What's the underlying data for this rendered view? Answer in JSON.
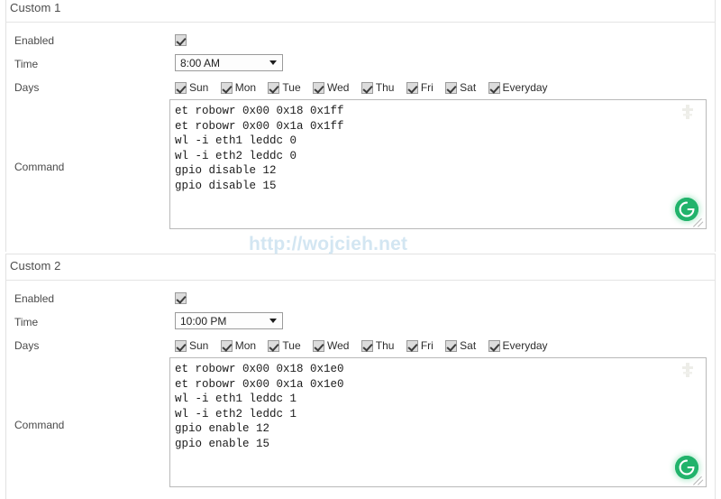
{
  "watermark": "http://wojcieh.net",
  "labels": {
    "enabled": "Enabled",
    "time": "Time",
    "days": "Days",
    "command": "Command"
  },
  "days": [
    "Sun",
    "Mon",
    "Tue",
    "Wed",
    "Thu",
    "Fri",
    "Sat",
    "Everyday"
  ],
  "colors": {
    "accent_green": "#21b36b",
    "watermark_blue": "#d3e6f2",
    "border_gray": "#e2e2e2"
  },
  "sections": [
    {
      "title": "Custom 1",
      "enabled": true,
      "time": "8:00 AM",
      "days_checked": [
        true,
        true,
        true,
        true,
        true,
        true,
        true,
        true
      ],
      "command": "et robowr 0x00 0x18 0x1ff\net robowr 0x00 0x1a 0x1ff\nwl -i eth1 leddc 0\nwl -i eth2 leddc 0\ngpio disable 12\ngpio disable 15"
    },
    {
      "title": "Custom 2",
      "enabled": true,
      "time": "10:00 PM",
      "days_checked": [
        true,
        true,
        true,
        true,
        true,
        true,
        true,
        true
      ],
      "command": "et robowr 0x00 0x18 0x1e0\net robowr 0x00 0x1a 0x1e0\nwl -i eth1 leddc 1\nwl -i eth2 leddc 1\ngpio enable 12\ngpio enable 15"
    }
  ],
  "icons": {
    "grammarly": "grammarly-icon",
    "dropdown_arrow": "chevron-down-icon",
    "resize": "resize-handle-icon"
  }
}
